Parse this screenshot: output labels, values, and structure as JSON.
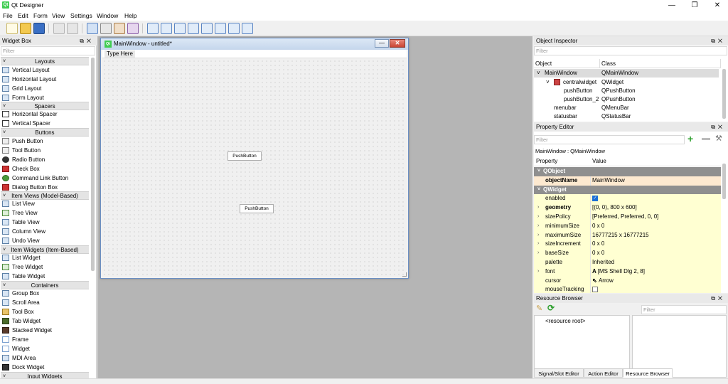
{
  "app": {
    "title": "Qt Designer",
    "icon_text": "Qt"
  },
  "menu": [
    "File",
    "Edit",
    "Form",
    "View",
    "Settings",
    "Window",
    "Help"
  ],
  "window_controls": {
    "minimize": "—",
    "maximize": "❐",
    "close": "✕"
  },
  "widget_box": {
    "title": "Widget Box",
    "filter_placeholder": "Filter",
    "categories": [
      {
        "name": "Layouts",
        "items": [
          "Vertical Layout",
          "Horizontal Layout",
          "Grid Layout",
          "Form Layout"
        ]
      },
      {
        "name": "Spacers",
        "items": [
          "Horizontal Spacer",
          "Vertical Spacer"
        ]
      },
      {
        "name": "Buttons",
        "items": [
          "Push Button",
          "Tool Button",
          "Radio Button",
          "Check Box",
          "Command Link Button",
          "Dialog Button Box"
        ]
      },
      {
        "name": "Item Views (Model-Based)",
        "items": [
          "List View",
          "Tree View",
          "Table View",
          "Column View",
          "Undo View"
        ]
      },
      {
        "name": "Item Widgets (Item-Based)",
        "items": [
          "List Widget",
          "Tree Widget",
          "Table Widget"
        ]
      },
      {
        "name": "Containers",
        "items": [
          "Group Box",
          "Scroll Area",
          "Tool Box",
          "Tab Widget",
          "Stacked Widget",
          "Frame",
          "Widget",
          "MDI Area",
          "Dock Widget"
        ]
      },
      {
        "name": "Input Widgets",
        "items": []
      }
    ]
  },
  "form": {
    "title": "MainWindow - untitled*",
    "icon_text": "Qt",
    "menu_placeholder": "Type Here",
    "buttons": [
      "PushButton",
      "PushButton"
    ]
  },
  "object_inspector": {
    "title": "Object Inspector",
    "filter_placeholder": "Filter",
    "headers": [
      "Object",
      "Class"
    ],
    "rows": [
      {
        "object": "MainWindow",
        "class": "QMainWindow"
      },
      {
        "object": "centralwidget",
        "class": "QWidget"
      },
      {
        "object": "pushButton",
        "class": "QPushButton"
      },
      {
        "object": "pushButton_2",
        "class": "QPushButton"
      },
      {
        "object": "menubar",
        "class": "QMenuBar"
      },
      {
        "object": "statusbar",
        "class": "QStatusBar"
      }
    ]
  },
  "property_editor": {
    "title": "Property Editor",
    "filter_placeholder": "Filter",
    "context": "MainWindow : QMainWindow",
    "headers": [
      "Property",
      "Value"
    ],
    "rows": [
      {
        "type": "group",
        "name": "QObject"
      },
      {
        "type": "prop",
        "name": "objectName",
        "value": "MainWindow",
        "bold": true,
        "color": "orange"
      },
      {
        "type": "group",
        "name": "QWidget"
      },
      {
        "type": "prop",
        "name": "enabled",
        "value": "",
        "checkbox": true,
        "checked": true,
        "color": "yellow"
      },
      {
        "type": "prop",
        "name": "geometry",
        "value": "[(0, 0), 800 x 600]",
        "bold": true,
        "expand": true,
        "color": "yellow"
      },
      {
        "type": "prop",
        "name": "sizePolicy",
        "value": "[Preferred, Preferred, 0, 0]",
        "expand": true,
        "color": "yellow"
      },
      {
        "type": "prop",
        "name": "minimumSize",
        "value": "0 x 0",
        "expand": true,
        "color": "yellow"
      },
      {
        "type": "prop",
        "name": "maximumSize",
        "value": "16777215 x 16777215",
        "expand": true,
        "color": "yellow"
      },
      {
        "type": "prop",
        "name": "sizeIncrement",
        "value": "0 x 0",
        "expand": true,
        "color": "yellow"
      },
      {
        "type": "prop",
        "name": "baseSize",
        "value": "0 x 0",
        "expand": true,
        "color": "yellow"
      },
      {
        "type": "prop",
        "name": "palette",
        "value": "Inherited",
        "color": "yellow"
      },
      {
        "type": "prop",
        "name": "font",
        "value": "[MS Shell Dlg 2, 8]",
        "icon": "A",
        "expand": true,
        "color": "yellow"
      },
      {
        "type": "prop",
        "name": "cursor",
        "value": "Arrow",
        "icon": "⇖",
        "color": "yellow"
      },
      {
        "type": "prop",
        "name": "mouseTracking",
        "value": "",
        "checkbox": true,
        "checked": false,
        "color": "yellow"
      }
    ]
  },
  "resource_browser": {
    "title": "Resource Browser",
    "filter_placeholder": "Filter",
    "root": "<resource root>"
  },
  "bottom_tabs": [
    "Signal/Slot Editor",
    "Action Editor",
    "Resource Browser"
  ],
  "colors": {
    "group_header": "#8f8f8f",
    "prop_yellow": "#ffffd2",
    "prop_orange": "#fde9d0",
    "qt_green": "#41cd52"
  }
}
